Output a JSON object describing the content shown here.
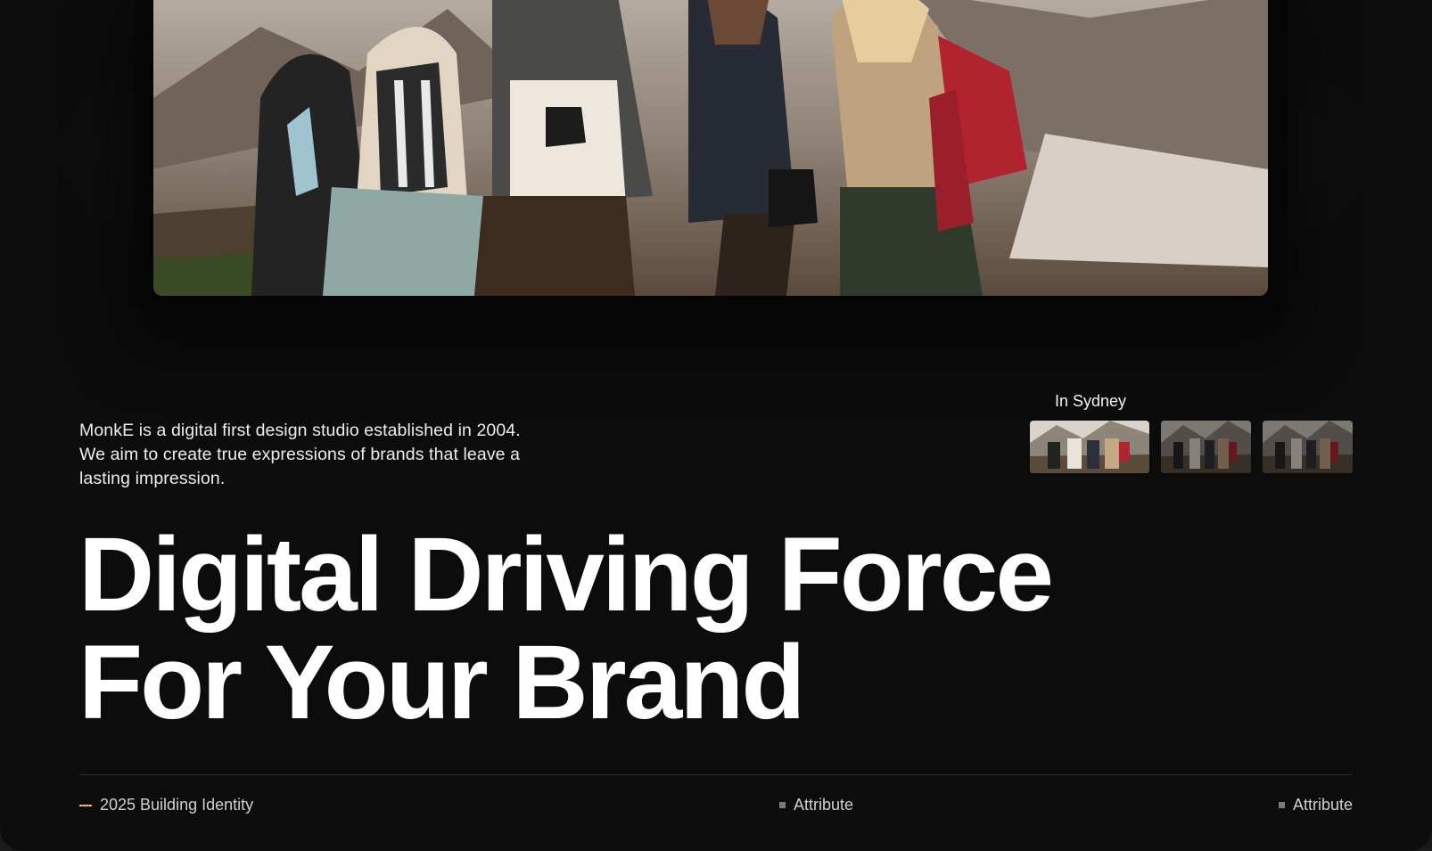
{
  "hero": {
    "image_alt": "Group of hikers with backpacks laughing together in the mountains"
  },
  "intro": {
    "text": "MonkE is a digital first design studio established in 2004. We aim to create true expressions of brands that leave a lasting impression."
  },
  "location": {
    "label": "In Sydney",
    "thumbnails": [
      {
        "name": "thumbnail-1",
        "active": true
      },
      {
        "name": "thumbnail-2",
        "active": false
      },
      {
        "name": "thumbnail-3",
        "active": false
      }
    ]
  },
  "headline": {
    "line1": "Digital Driving Force",
    "line2": "For Your Brand"
  },
  "footer": {
    "left_label": "2025 Building Identity",
    "mid_label": "Attribute",
    "right_label": "Attribute"
  },
  "colors": {
    "background": "#0c0c0c",
    "accent": "#f5b73b",
    "text": "#ffffff",
    "muted": "#cfcfcf"
  },
  "icons": {
    "left_marker": "dash-icon",
    "attribute_marker": "square-icon"
  }
}
